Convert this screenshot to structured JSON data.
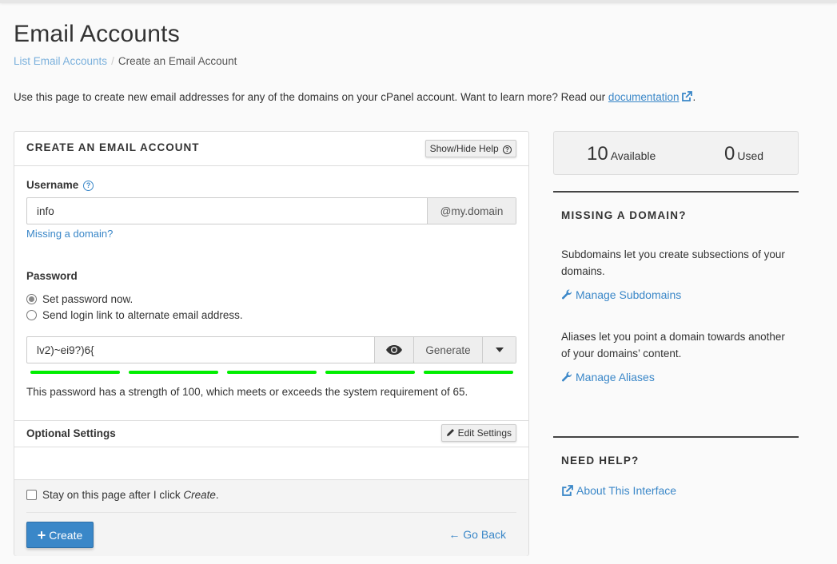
{
  "page": {
    "title": "Email Accounts",
    "breadcrumb": {
      "parent": "List Email Accounts",
      "separator": "/",
      "current": "Create an Email Account"
    },
    "intro": {
      "text": "Use this page to create new email addresses for any of the domains on your cPanel account. Want to learn more? Read our ",
      "link": "documentation",
      "suffix": "."
    }
  },
  "form": {
    "heading": "CREATE AN EMAIL ACCOUNT",
    "help_button": "Show/Hide Help",
    "username": {
      "label": "Username",
      "value": "info",
      "domain_addon": "@my.domain",
      "missing_domain_link": "Missing a domain?"
    },
    "password": {
      "label": "Password",
      "options": [
        {
          "label": "Set password now.",
          "checked": true
        },
        {
          "label": "Send login link to alternate email address.",
          "checked": false
        }
      ],
      "value": "lv2)~ei9?)6{",
      "generate_label": "Generate",
      "strength_percent": 100,
      "strength_segments_filled": 5,
      "strength_color": "#00ee00",
      "strength_text": "This password has a strength of 100, which meets or exceeds the system requirement of 65."
    },
    "optional": {
      "label": "Optional Settings",
      "edit_button": "Edit Settings"
    },
    "footer": {
      "stay_label": "Stay on this page after I click ",
      "stay_label_em": "Create",
      "stay_label_end": ".",
      "stay_checked": false,
      "create_button": "Create",
      "go_back": "Go Back"
    }
  },
  "sidebar": {
    "stats": {
      "available_num": "10",
      "available_label": "Available",
      "used_num": "0",
      "used_label": "Used"
    },
    "missing_domain": {
      "heading": "MISSING A DOMAIN?",
      "subdomains_text": "Subdomains let you create subsections of your domains.",
      "subdomains_link": "Manage Subdomains",
      "aliases_text": "Aliases let you point a domain towards another of your domains’ content.",
      "aliases_link": "Manage Aliases"
    },
    "need_help": {
      "heading": "NEED HELP?",
      "link": "About This Interface"
    }
  },
  "colors": {
    "link": "#3a87c8",
    "primary_button": "#3a87c8",
    "strength_bar": "#00ee00"
  }
}
